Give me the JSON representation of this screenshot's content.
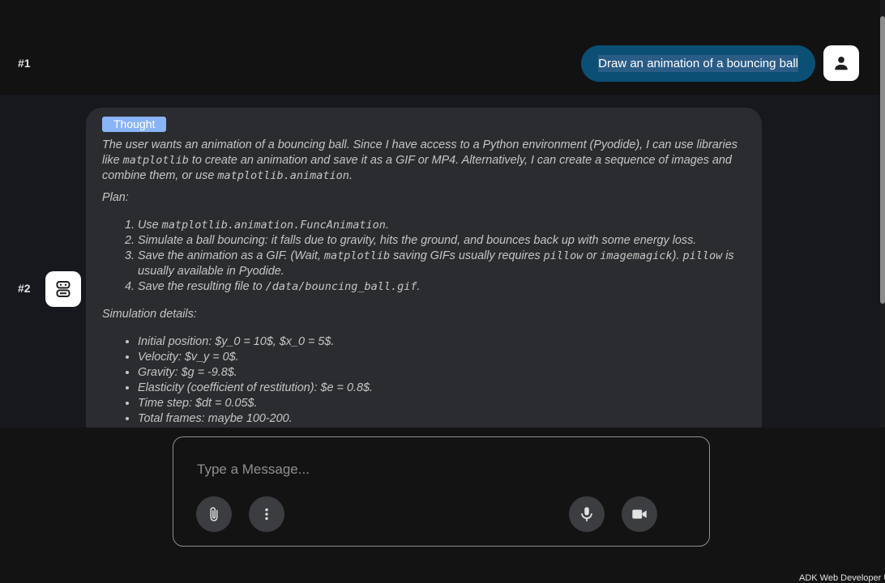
{
  "turns": [
    {
      "number": "#1",
      "role": "user",
      "message": "Draw an animation of a bouncing ball",
      "avatar_icon": "person-icon"
    },
    {
      "number": "#2",
      "role": "bot",
      "avatar_icon": "robot-icon"
    }
  ],
  "thought": {
    "badge": "Thought",
    "intro_parts": [
      "The user wants an animation of a bouncing ball. Since I have access to a Python environment (Pyodide), I can use libraries like ",
      "matplotlib",
      " to create an animation and save it as a GIF or MP4. Alternatively, I can create a sequence of images and combine them, or use ",
      "matplotlib.animation",
      "."
    ],
    "plan_label": "Plan:",
    "plan_items": [
      {
        "parts": [
          "Use ",
          "matplotlib.animation.FuncAnimation",
          "."
        ]
      },
      {
        "parts": [
          "Simulate a ball bouncing: it falls due to gravity, hits the ground, and bounces back up with some energy loss."
        ]
      },
      {
        "parts": [
          "Save the animation as a GIF. (Wait, ",
          "matplotlib",
          " saving GIFs usually requires ",
          "pillow",
          " or ",
          "imagemagick",
          "). ",
          "pillow",
          " is usually available in Pyodide."
        ]
      },
      {
        "parts": [
          "Save the resulting file to ",
          "/data/bouncing_ball.gif",
          "."
        ]
      }
    ],
    "simulation_label": "Simulation details:",
    "simulation_items": [
      "Initial position: $y_0 = 10$, $x_0 = 5$.",
      "Velocity: $v_y = 0$.",
      "Gravity: $g = -9.8$.",
      "Elasticity (coefficient of restitution): $e = 0.8$.",
      "Time step: $dt = 0.05$.",
      "Total frames: maybe 100-200."
    ]
  },
  "composer": {
    "placeholder": "Type a Message...",
    "attach_icon": "paperclip-icon",
    "more_icon": "more-vert-icon",
    "mic_icon": "microphone-icon",
    "video_icon": "video-camera-icon"
  },
  "footer": "ADK Web Developer U",
  "colors": {
    "user_bubble": "#0b4f75",
    "thought_badge": "#8ab4f8",
    "bot_bubble": "#2b2c2f",
    "background": "#131314"
  }
}
